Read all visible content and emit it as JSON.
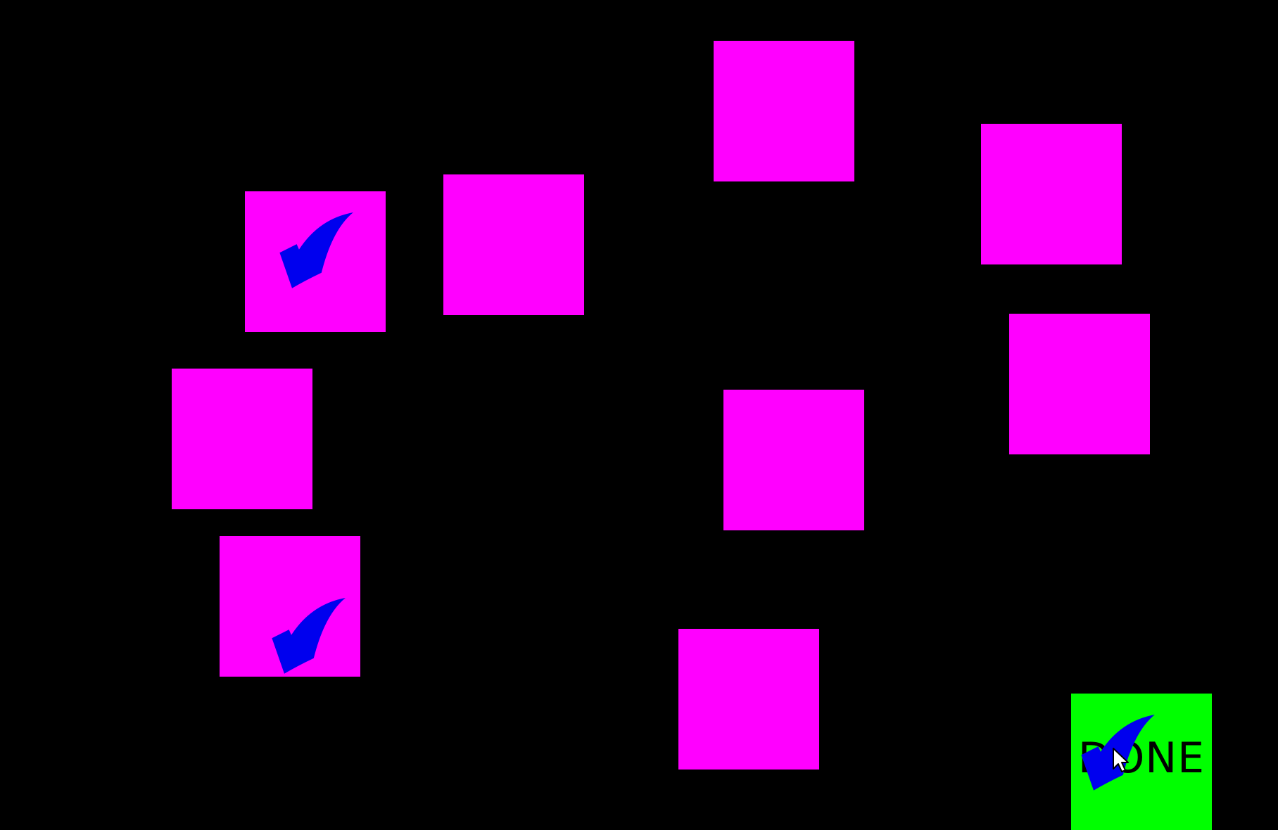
{
  "colors": {
    "background": "#000000",
    "tile": "#FF00FF",
    "check": "#0000EE",
    "done_button": "#00FF00",
    "done_text": "#000000"
  },
  "tiles": [
    {
      "id": 1,
      "checked": true
    },
    {
      "id": 2,
      "checked": false
    },
    {
      "id": 3,
      "checked": false
    },
    {
      "id": 4,
      "checked": false
    },
    {
      "id": 5,
      "checked": false
    },
    {
      "id": 6,
      "checked": false
    },
    {
      "id": 7,
      "checked": false
    },
    {
      "id": 8,
      "checked": true
    },
    {
      "id": 9,
      "checked": false
    }
  ],
  "done_button": {
    "label": "DONE",
    "checked": true
  },
  "icons": {
    "check": "checkmark-icon",
    "cursor": "mouse-pointer-icon"
  }
}
